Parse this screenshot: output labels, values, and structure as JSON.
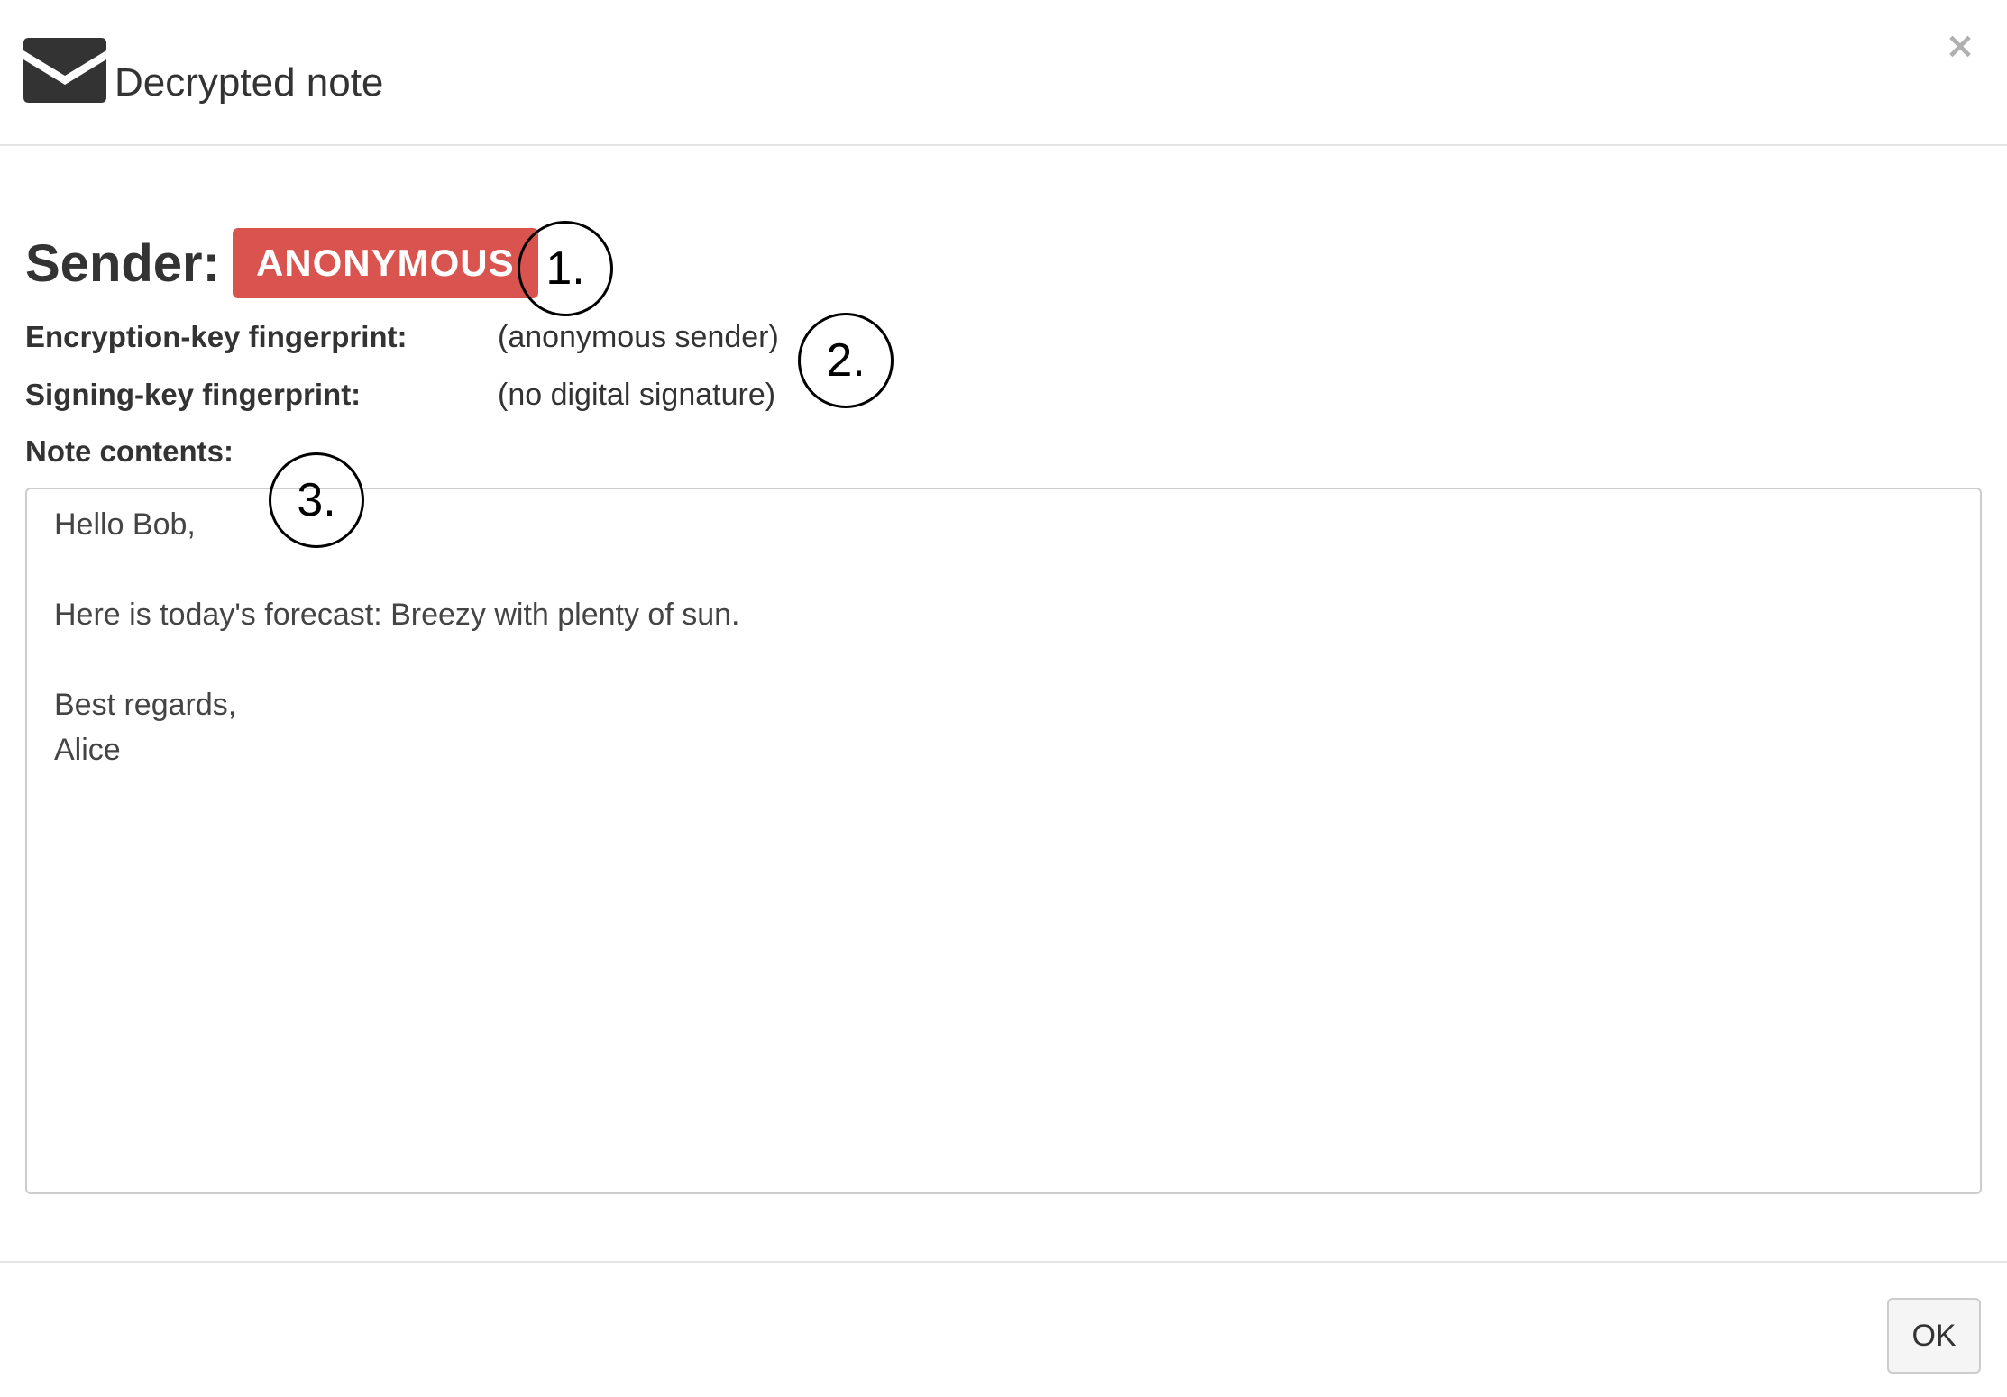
{
  "header": {
    "icon": "envelope-icon",
    "title": "Decrypted note",
    "close_icon": "close-icon",
    "close_glyph": "×"
  },
  "sender": {
    "label": "Sender:",
    "badge": "ANONYMOUS",
    "badge_color": "#d9534f"
  },
  "fields": {
    "encryption_label": "Encryption-key fingerprint:",
    "encryption_value": "(anonymous sender)",
    "signing_label": "Signing-key fingerprint:",
    "signing_value": "(no digital signature)",
    "note_label": "Note contents:"
  },
  "note": {
    "lines": [
      "Hello Bob,",
      "",
      "Here is today's forecast: Breezy with plenty of sun.",
      "",
      "Best regards,",
      "Alice"
    ]
  },
  "callouts": {
    "one": "1.",
    "two": "2.",
    "three": "3."
  },
  "footer": {
    "ok_label": "OK"
  }
}
